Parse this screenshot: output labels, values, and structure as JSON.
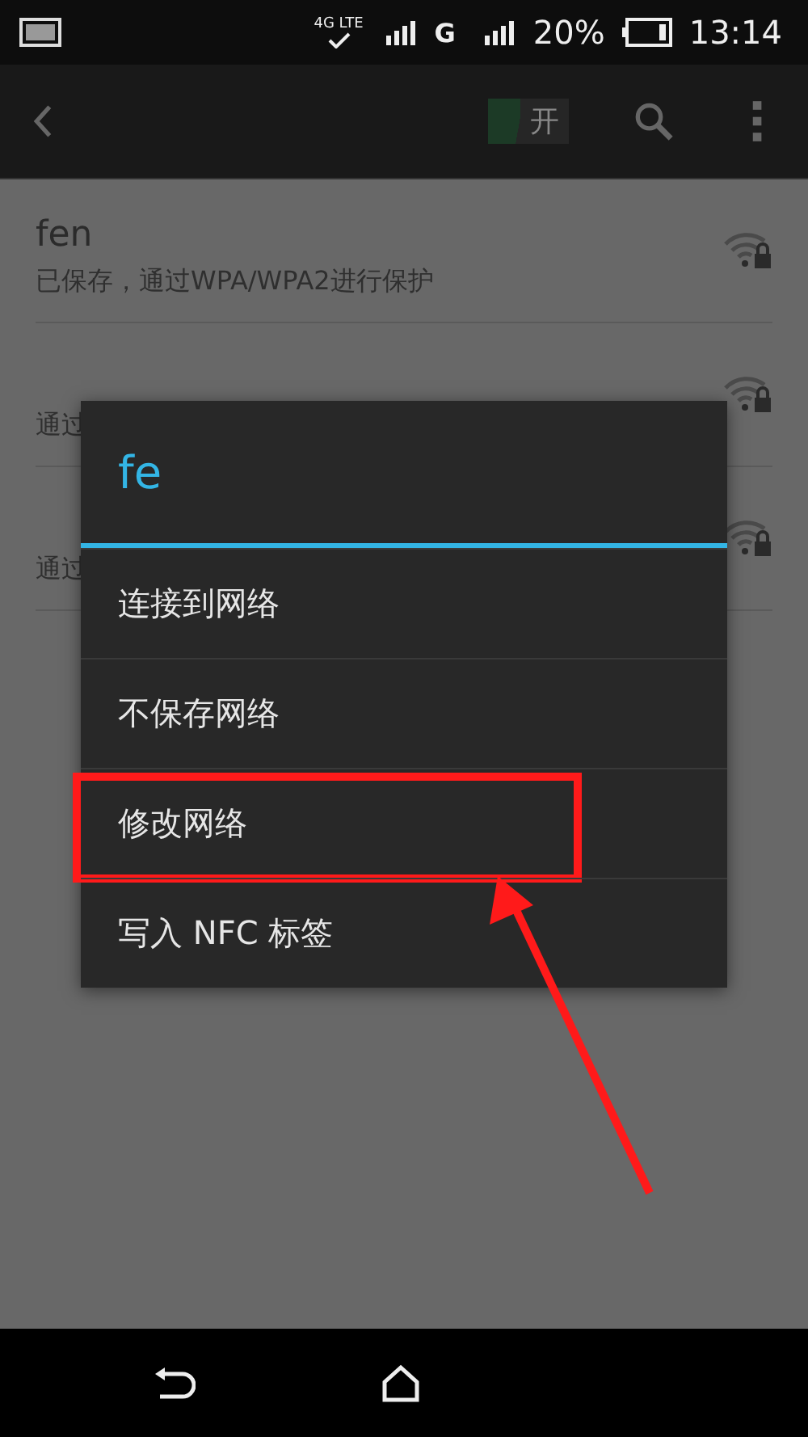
{
  "status_bar": {
    "network_type": "4G LTE",
    "carrier": "G",
    "battery": "20%",
    "time": "13:14"
  },
  "action_bar": {
    "switch": {
      "label": "开",
      "on": true
    }
  },
  "networks": [
    {
      "name": "fen",
      "summary": "已保存，通过WPA/WPA2进行保护"
    },
    {
      "summary": "通过"
    },
    {
      "summary": "通过"
    }
  ],
  "dialog": {
    "title": "fe",
    "items": [
      {
        "label": "连接到网络",
        "highlighted": false
      },
      {
        "label": "不保存网络",
        "highlighted": false
      },
      {
        "label": "修改网络",
        "highlighted": true
      },
      {
        "label": "写入 NFC 标签",
        "highlighted": false
      }
    ]
  }
}
